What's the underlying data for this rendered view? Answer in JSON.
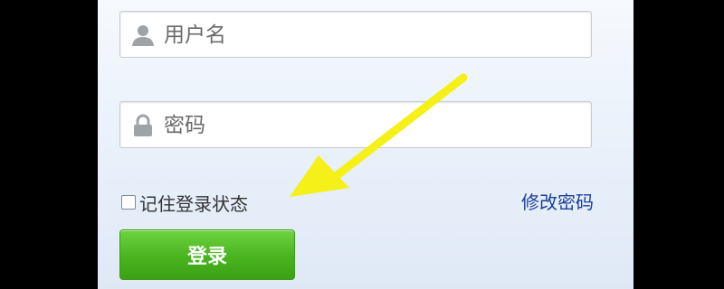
{
  "form": {
    "username_placeholder": "用户名",
    "username_icon": "user-icon",
    "password_placeholder": "密码",
    "password_icon": "lock-icon",
    "remember_label": "记住登录状态",
    "remember_checked": false,
    "change_password_link": "修改密码",
    "login_button": "登录"
  },
  "annotation": {
    "type": "arrow",
    "color": "#f5f018",
    "points_to": "remember-checkbox"
  },
  "colors": {
    "link": "#1b3f9a",
    "button_green": "#48b41f",
    "panel_bg": "#e8f0fa"
  }
}
